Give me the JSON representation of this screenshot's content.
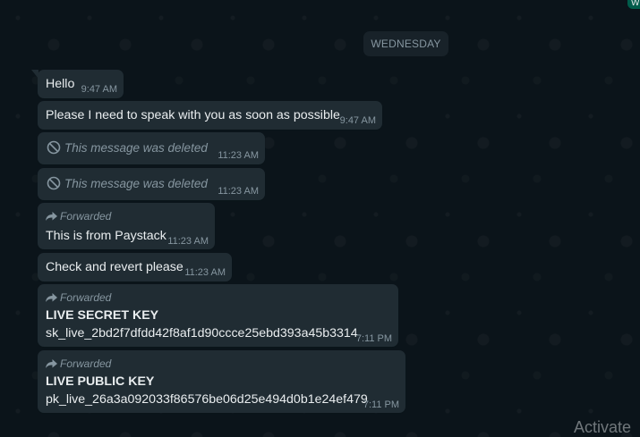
{
  "chat": {
    "date_divider": "WEDNESDAY",
    "corner_label": "W",
    "messages": [
      {
        "text": "Hello",
        "time": "9:47 AM"
      },
      {
        "text": "Please I need to speak with you as soon as possible",
        "time": "9:47 AM"
      },
      {
        "deleted_text": "This message was deleted",
        "time": "11:23 AM"
      },
      {
        "deleted_text": "This message was deleted",
        "time": "11:23 AM"
      },
      {
        "forwarded_label": "Forwarded",
        "text": "This is from Paystack",
        "time": "11:23 AM"
      },
      {
        "text": "Check and revert please",
        "time": "11:23 AM"
      },
      {
        "forwarded_label": "Forwarded",
        "title": "LIVE SECRET KEY",
        "text": "sk_live_2bd2f7dfdd42f8af1d90ccce25ebd393a45b3314",
        "time": "7:11 PM"
      },
      {
        "forwarded_label": "Forwarded",
        "title": "LIVE PUBLIC KEY",
        "text": "pk_live_26a3a092033f86576be06d25e494d0b1e24ef479",
        "time": "7:11 PM"
      }
    ]
  },
  "overlay": {
    "activate_watermark": "Activate"
  },
  "icons": {
    "deleted": "ban-icon",
    "forwarded": "forward-arrow-icon"
  },
  "colors": {
    "background": "#0b141a",
    "bubble": "#202c33",
    "meta_text": "#8696a0",
    "text": "#e9edef"
  }
}
